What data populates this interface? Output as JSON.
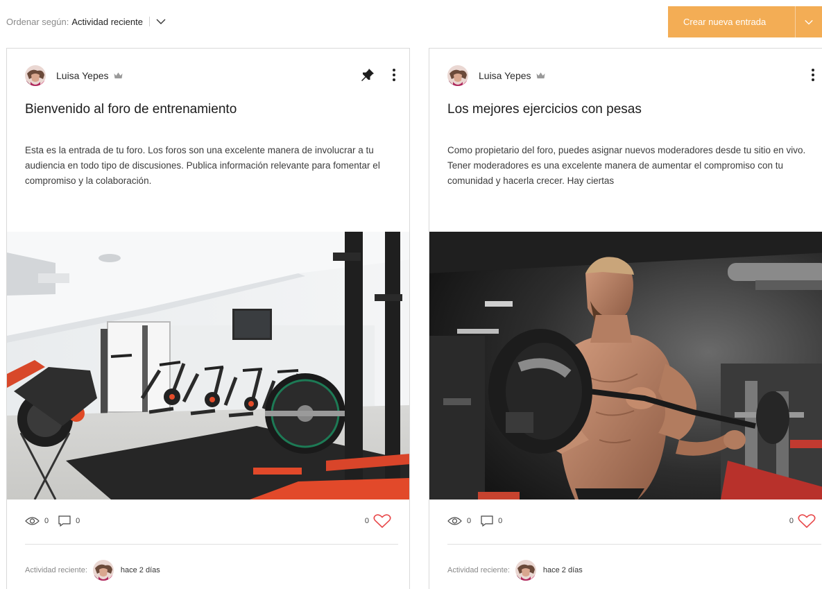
{
  "sort": {
    "label": "Ordenar según:",
    "value": "Actividad reciente"
  },
  "create_button": {
    "label": "Crear nueva entrada"
  },
  "colors": {
    "accent": "#f3ad55",
    "heart": "#e8484a",
    "border": "#d9d9d9"
  },
  "posts": [
    {
      "author": "Luisa Yepes",
      "title": "Bienvenido al foro de entrenamiento",
      "excerpt": "Esta es la entrada de tu foro. Los foros son una excelente manera de involucrar a tu audiencia en todo tipo de discusiones. Publica información relevante para fomentar el compromiso y la colaboración.",
      "views": "0",
      "comments": "0",
      "likes": "0",
      "recent_label": "Actividad reciente:",
      "recent_time": "hace 2 días",
      "pinned": true
    },
    {
      "author": "Luisa Yepes",
      "title": "Los mejores ejercicios con pesas",
      "excerpt": "Como propietario del foro, puedes asignar nuevos moderadores desde tu sitio en vivo. Tener moderadores es una excelente manera de aumentar el compromiso con tu comunidad y hacerla crecer. Hay ciertas",
      "views": "0",
      "comments": "0",
      "likes": "0",
      "recent_label": "Actividad reciente:",
      "recent_time": "hace 2 días",
      "pinned": false
    }
  ]
}
